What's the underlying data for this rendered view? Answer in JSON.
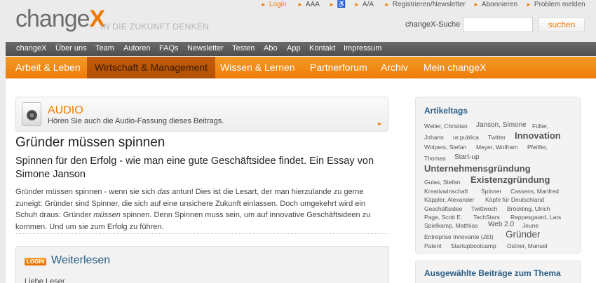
{
  "brand": {
    "logo_main": "change",
    "logo_accent": "X",
    "tagline": "IN DIE ZUKUNFT DENKEN"
  },
  "toplinks": [
    {
      "label": "Login",
      "highlight": true
    },
    {
      "label": "AAA",
      "highlight": false
    },
    {
      "label": "♿",
      "highlight": false
    },
    {
      "label": "A/A",
      "highlight": false
    },
    {
      "label": "Registrieren/Newsletter",
      "highlight": false
    },
    {
      "label": "Abonnieren",
      "highlight": false
    },
    {
      "label": "Problem melden",
      "highlight": false
    }
  ],
  "search": {
    "label": "changeX-Suche",
    "value": "",
    "button": "suchen"
  },
  "topnav": [
    "changeX",
    "Über uns",
    "Team",
    "Autoren",
    "FAQs",
    "Newsletter",
    "Testen",
    "Abo",
    "App",
    "Kontakt",
    "Impressum"
  ],
  "mainnav": [
    {
      "label": "Arbeit & Leben",
      "active": false
    },
    {
      "label": "Wirtschaft & Management",
      "active": true
    },
    {
      "label": "Wissen & Lernen",
      "active": false
    },
    {
      "label": "Partnerforum",
      "active": false
    },
    {
      "label": "Archiv",
      "active": false
    },
    {
      "label": "Mein changeX",
      "active": false
    }
  ],
  "audio": {
    "title": "AUDIO",
    "subtitle": "Hören Sie auch die Audio-Fassung dieses Beitrags."
  },
  "article": {
    "title": "Gründer müssen spinnen",
    "lead": "Spinnen für den Erfolg - wie man eine gute Geschäftsidee findet. Ein Essay von Simone Janson",
    "body_1": "Gründer müssen spinnen - wenn sie sich ",
    "body_em_1": "das",
    "body_2": " antun! Dies ist die Lesart, der man hierzulande zu gerne zuneigt: Gründer sind Spinner, die sich auf eine unsichere Zukunft einlassen. Doch umgekehrt wird ein Schuh draus: Gründer ",
    "body_em_2": "müssen",
    "body_3": " spinnen. Denn Spinnen muss sein, um auf innovative Geschäftsideen zu kommen. Und um sie zum Erfolg zu führen."
  },
  "weiterlesen": {
    "badge": "LOGIN",
    "title": "Weiterlesen",
    "text": "Liebe Leser"
  },
  "tags_box": {
    "title": "Artikeltags",
    "tags": [
      "Weiler, Christian",
      "Janson, Simone",
      "Füller,",
      "Johann",
      "re:publica",
      "Twitter",
      "Innovation",
      "Wolpers, Stefan",
      "Meyer, Wolfram",
      "Pfeiffer,",
      "Thomas",
      "Start-up",
      "Unternehmensgründung",
      "Gulas, Stefan",
      "Existenzgründung",
      "Kreativwirtschaft",
      "Spinner",
      "Cassens, Manfred",
      "Käppler, Alexander",
      "Köpfe für Deutschland",
      "Geschäftsidee",
      "Twittwoch",
      "Bröckling, Ulrich",
      "Page, Scott E.",
      "TechStars",
      "Reppesgaard, Lars",
      "Spielkamp, Matthias",
      "Web 2.0",
      "Jeune",
      "Entreprise Innovante (JEI)",
      "Gründer",
      "Patent",
      "Startupbootcamp",
      "Ostner, Manuel"
    ]
  },
  "related": {
    "title": "Ausgewählte Beiträge zum Thema"
  }
}
